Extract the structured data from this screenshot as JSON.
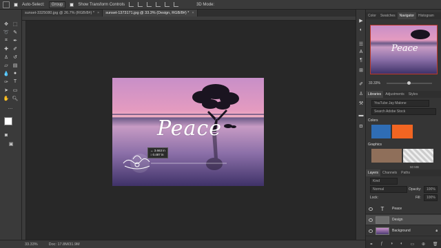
{
  "options_bar": {
    "auto_select_label": "Auto-Select:",
    "auto_select_value": "Group",
    "show_transform_label": "Show Transform Controls",
    "mode_3d": "3D Mode:"
  },
  "document_tabs": [
    {
      "label": "sunset-3325080.jpg @ 26.7% (RGB/8#) *",
      "active": false
    },
    {
      "label": "sunset-1373171.jpg @ 33.3% (Design, RGB/8#) *",
      "active": true
    }
  ],
  "canvas": {
    "title_text": "Peace",
    "measure_w": "↔ 3.663 in",
    "measure_h": "↕ 0.487 in"
  },
  "status_bar": {
    "zoom": "33.33%",
    "doc": "Doc: 17.8M/31.9M"
  },
  "navigator": {
    "tabs": [
      "Color",
      "Swatches",
      "Navigator",
      "Histogram"
    ],
    "active_tab": "Navigator",
    "preview_text": "Peace",
    "zoom": "33.33%"
  },
  "libraries": {
    "tabs": [
      "Libraries",
      "Adjustments",
      "Styles"
    ],
    "library_name": "YouTube Jay Malone",
    "search_placeholder": "Search Adobe Stock",
    "colors_label": "Colors",
    "colors": [
      "#2f6db5",
      "#f16522"
    ],
    "graphics_label": "Graphics",
    "size_label": "50 MB"
  },
  "layers": {
    "tabs": [
      "Layers",
      "Channels",
      "Paths"
    ],
    "kind_filter": "Kind",
    "blend_mode": "Normal",
    "opacity_label": "Opacity:",
    "opacity_value": "100%",
    "lock_label": "Lock:",
    "fill_label": "Fill:",
    "fill_value": "100%",
    "items": [
      {
        "name": "Peace",
        "type": "text",
        "selected": false
      },
      {
        "name": "Design",
        "type": "image",
        "selected": true
      },
      {
        "name": "Background",
        "type": "image",
        "selected": false
      }
    ]
  },
  "colors": {
    "foreground": "#ffffff",
    "background": "#000000",
    "accent": "#2f6db5"
  }
}
